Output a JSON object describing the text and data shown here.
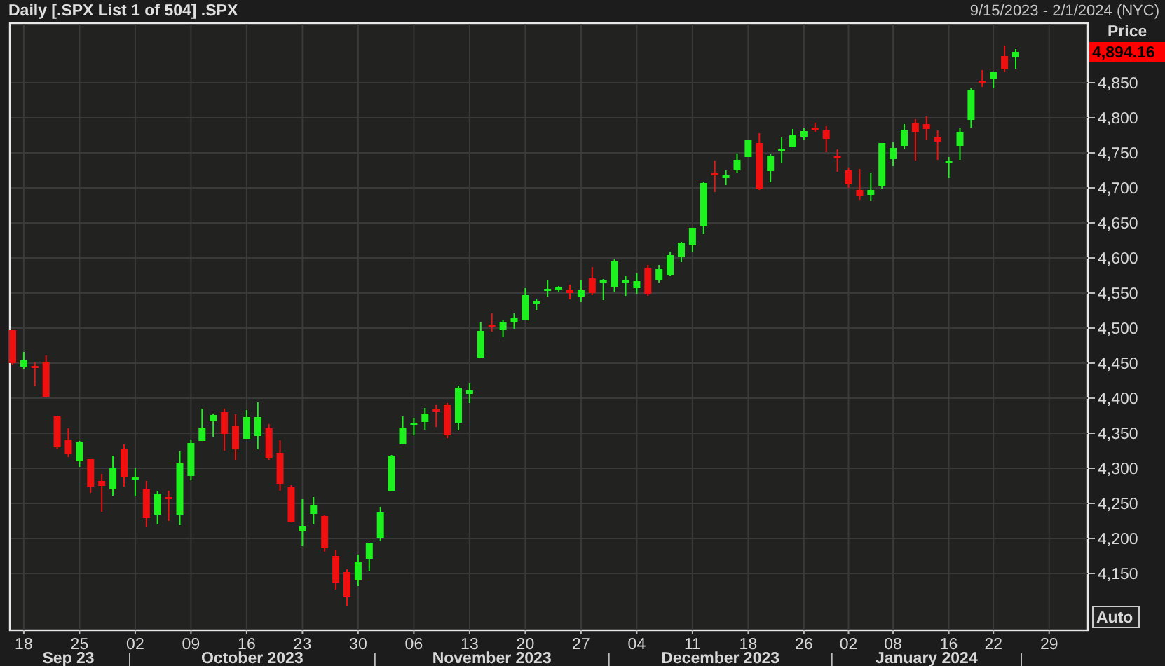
{
  "header": {
    "title": "Daily [.SPX List 1 of 504] .SPX",
    "date_range": "9/15/2023 - 2/1/2024 (NYC)"
  },
  "chart": {
    "chart_data": {
      "type": "candlestick",
      "ylabel": "Price",
      "categories": [
        null,
        "18",
        null,
        null,
        null,
        null,
        "25",
        null,
        null,
        null,
        null,
        "02",
        null,
        null,
        null,
        null,
        "09",
        null,
        null,
        null,
        null,
        "16",
        null,
        null,
        null,
        null,
        "23",
        null,
        null,
        null,
        null,
        "30",
        null,
        null,
        null,
        null,
        "06",
        null,
        null,
        null,
        null,
        "13",
        null,
        null,
        null,
        null,
        "20",
        null,
        null,
        null,
        null,
        "27",
        null,
        null,
        null,
        null,
        "04",
        null,
        null,
        null,
        null,
        "11",
        null,
        null,
        null,
        null,
        "18",
        null,
        null,
        null,
        null,
        "26",
        null,
        null,
        null,
        "02",
        null,
        null,
        null,
        "08",
        null,
        null,
        null,
        null,
        "16",
        null,
        null,
        null,
        "22",
        null,
        null,
        null,
        null,
        "29"
      ],
      "ohlc": [
        [
          4497,
          4497,
          4448,
          4450
        ],
        [
          4445,
          4466,
          4442,
          4454
        ],
        [
          4446,
          4451,
          4417,
          4444
        ],
        [
          4452,
          4461,
          4401,
          4402
        ],
        [
          4374,
          4375,
          4328,
          4330
        ],
        [
          4341,
          4357,
          4316,
          4320
        ],
        [
          4310,
          4339,
          4302,
          4337
        ],
        [
          4313,
          4313,
          4265,
          4274
        ],
        [
          4282,
          4292,
          4238,
          4275
        ],
        [
          4270,
          4318,
          4261,
          4300
        ],
        [
          4328,
          4334,
          4274,
          4288
        ],
        [
          4284,
          4300,
          4260,
          4288
        ],
        [
          4270,
          4282,
          4216,
          4229
        ],
        [
          4234,
          4268,
          4220,
          4263
        ],
        [
          4259,
          4268,
          4225,
          4258
        ],
        [
          4234,
          4324,
          4219,
          4308
        ],
        [
          4289,
          4341,
          4283,
          4336
        ],
        [
          4339,
          4385,
          4339,
          4358
        ],
        [
          4367,
          4378,
          4345,
          4376
        ],
        [
          4380,
          4385,
          4325,
          4349
        ],
        [
          4360,
          4377,
          4312,
          4327
        ],
        [
          4342,
          4383,
          4342,
          4373
        ],
        [
          4346,
          4394,
          4327,
          4373
        ],
        [
          4357,
          4363,
          4312,
          4314
        ],
        [
          4322,
          4340,
          4268,
          4278
        ],
        [
          4273,
          4276,
          4223,
          4224
        ],
        [
          4210,
          4256,
          4189,
          4217
        ],
        [
          4235,
          4259,
          4220,
          4248
        ],
        [
          4232,
          4233,
          4181,
          4186
        ],
        [
          4175,
          4184,
          4127,
          4137
        ],
        [
          4152,
          4156,
          4104,
          4117
        ],
        [
          4140,
          4177,
          4132,
          4167
        ],
        [
          4171,
          4194,
          4153,
          4193
        ],
        [
          4201,
          4245,
          4197,
          4237
        ],
        [
          4268,
          4319,
          4268,
          4318
        ],
        [
          4334,
          4374,
          4334,
          4358
        ],
        [
          4364,
          4372,
          4347,
          4365
        ],
        [
          4366,
          4386,
          4355,
          4378
        ],
        [
          4384,
          4391,
          4359,
          4382
        ],
        [
          4391,
          4393,
          4343,
          4347
        ],
        [
          4365,
          4418,
          4354,
          4415
        ],
        [
          4406,
          4421,
          4393,
          4411
        ],
        [
          4458,
          4508,
          4458,
          4496
        ],
        [
          4505,
          4521,
          4495,
          4502
        ],
        [
          4497,
          4511,
          4487,
          4508
        ],
        [
          4509,
          4521,
          4499,
          4514
        ],
        [
          4511,
          4557,
          4511,
          4547
        ],
        [
          4538,
          4542,
          4526,
          4538
        ],
        [
          4553,
          4568,
          4545,
          4556
        ],
        [
          4555,
          4560,
          4552,
          4559
        ],
        [
          4555,
          4562,
          4541,
          4550
        ],
        [
          4545,
          4568,
          4537,
          4554
        ],
        [
          4571,
          4587,
          4547,
          4550
        ],
        [
          4568,
          4570,
          4540,
          4568
        ],
        [
          4559,
          4599,
          4552,
          4595
        ],
        [
          4564,
          4574,
          4546,
          4569
        ],
        [
          4557,
          4578,
          4549,
          4567
        ],
        [
          4586,
          4590,
          4546,
          4549
        ],
        [
          4568,
          4590,
          4565,
          4585
        ],
        [
          4576,
          4609,
          4574,
          4604
        ],
        [
          4601,
          4623,
          4594,
          4622
        ],
        [
          4618,
          4643,
          4608,
          4643
        ],
        [
          4646,
          4709,
          4634,
          4707
        ],
        [
          4721,
          4739,
          4694,
          4719
        ],
        [
          4714,
          4725,
          4704,
          4719
        ],
        [
          4725,
          4749,
          4721,
          4740
        ],
        [
          4744,
          4768,
          4744,
          4768
        ],
        [
          4764,
          4778,
          4697,
          4698
        ],
        [
          4724,
          4749,
          4708,
          4746
        ],
        [
          4753,
          4772,
          4736,
          4755
        ],
        [
          4759,
          4784,
          4758,
          4775
        ],
        [
          4773,
          4785,
          4768,
          4781
        ],
        [
          4786,
          4793,
          4780,
          4783
        ],
        [
          4782,
          4788,
          4751,
          4770
        ],
        [
          4745,
          4755,
          4723,
          4743
        ],
        [
          4725,
          4729,
          4700,
          4705
        ],
        [
          4697,
          4727,
          4683,
          4688
        ],
        [
          4690,
          4721,
          4682,
          4697
        ],
        [
          4703,
          4764,
          4699,
          4764
        ],
        [
          4741,
          4765,
          4731,
          4757
        ],
        [
          4760,
          4791,
          4756,
          4783
        ],
        [
          4792,
          4798,
          4739,
          4780
        ],
        [
          4791,
          4802,
          4768,
          4784
        ],
        [
          4772,
          4782,
          4740,
          4766
        ],
        [
          4739,
          4744,
          4714,
          4739
        ],
        [
          4760,
          4785,
          4740,
          4780
        ],
        [
          4797,
          4842,
          4786,
          4840
        ],
        [
          4853,
          4868,
          4844,
          4851
        ],
        [
          4856,
          4866,
          4842,
          4865
        ],
        [
          4888,
          4903,
          4865,
          4869
        ],
        [
          4886,
          4898,
          4870,
          4894
        ],
        null,
        null,
        null
      ],
      "grid": true,
      "ylim": [
        4070,
        4936
      ],
      "yticks": [
        {
          "value": 4150,
          "label": "4,150"
        },
        {
          "value": 4200,
          "label": "4,200"
        },
        {
          "value": 4250,
          "label": "4,250"
        },
        {
          "value": 4300,
          "label": "4,300"
        },
        {
          "value": 4350,
          "label": "4,350"
        },
        {
          "value": 4400,
          "label": "4,400"
        },
        {
          "value": 4450,
          "label": "4,450"
        },
        {
          "value": 4500,
          "label": "4,500"
        },
        {
          "value": 4550,
          "label": "4,550"
        },
        {
          "value": 4600,
          "label": "4,600"
        },
        {
          "value": 4650,
          "label": "4,650"
        },
        {
          "value": 4700,
          "label": "4,700"
        },
        {
          "value": 4750,
          "label": "4,750"
        },
        {
          "value": 4800,
          "label": "4,800"
        },
        {
          "value": 4850,
          "label": "4,850"
        }
      ]
    },
    "last_price": "4,894.16",
    "months": [
      "Sep 23",
      "October 2023",
      "November 2023",
      "December 2023",
      "January 2024"
    ],
    "auto_button": "Auto"
  }
}
